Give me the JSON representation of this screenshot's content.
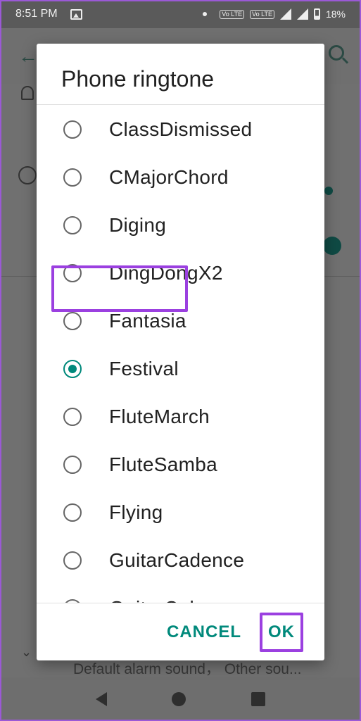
{
  "status_bar": {
    "time": "8:51 PM",
    "battery": "18%",
    "volte1": "Vo LTE",
    "volte2": "Vo LTE"
  },
  "background": {
    "subtitle": "Default alarm sound， Other sou..."
  },
  "dialog": {
    "title": "Phone ringtone",
    "options": [
      {
        "label": "ClassDismissed",
        "checked": false
      },
      {
        "label": "CMajorChord",
        "checked": false
      },
      {
        "label": "Diging",
        "checked": false
      },
      {
        "label": "DingDongX2",
        "checked": false
      },
      {
        "label": "Fantasia",
        "checked": false
      },
      {
        "label": "Festival",
        "checked": true
      },
      {
        "label": "FluteMarch",
        "checked": false
      },
      {
        "label": "FluteSamba",
        "checked": false
      },
      {
        "label": "Flying",
        "checked": false
      },
      {
        "label": "GuitarCadence",
        "checked": false
      },
      {
        "label": "GuitarCab",
        "checked": false
      }
    ],
    "cancel_label": "CANCEL",
    "ok_label": "OK"
  },
  "colors": {
    "accent": "#00897b",
    "highlight": "#9b40e0"
  }
}
